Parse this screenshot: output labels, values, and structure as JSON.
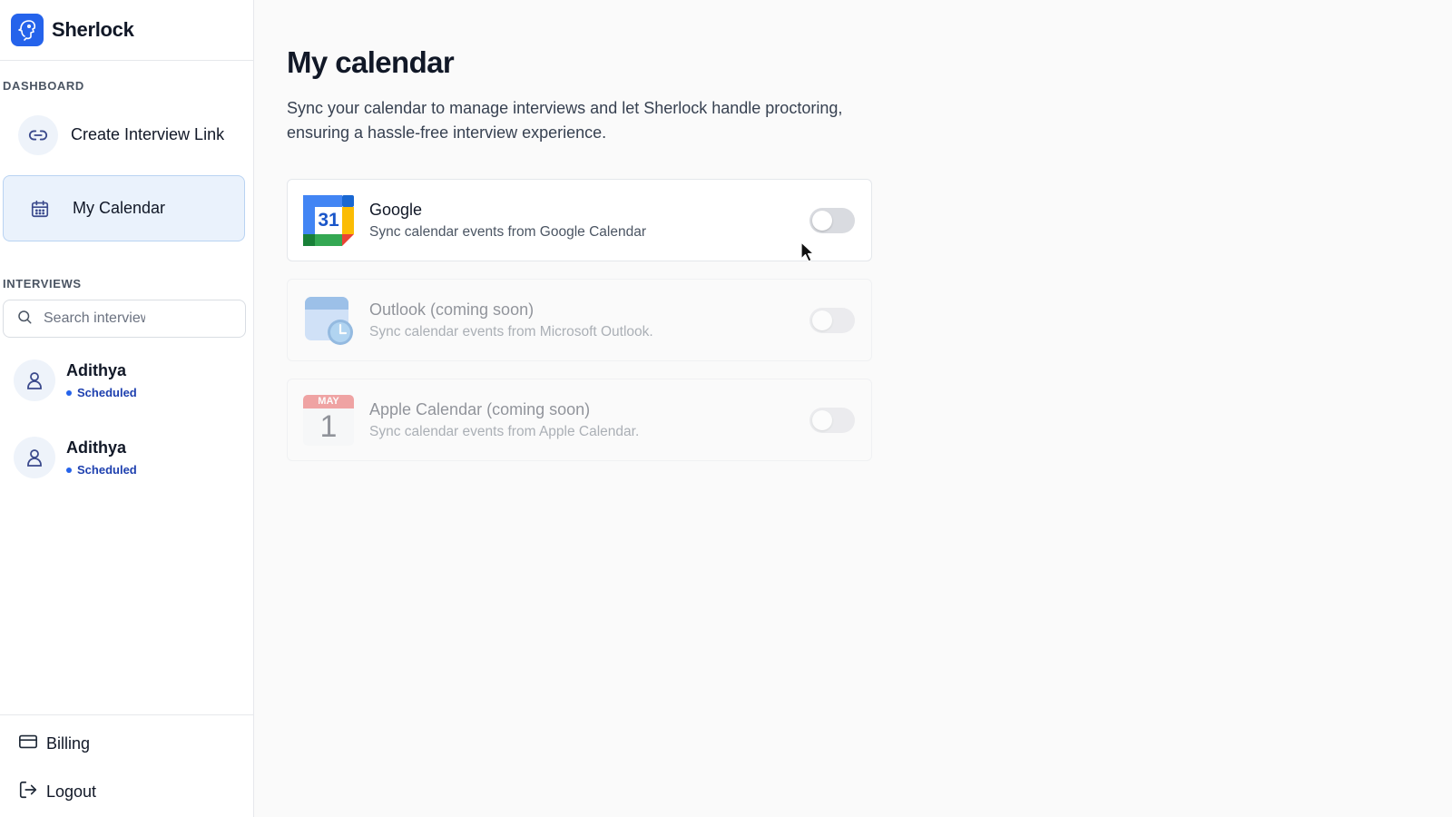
{
  "brand": {
    "name": "Sherlock",
    "color": "#2563eb"
  },
  "sidebar": {
    "dashboard_label": "DASHBOARD",
    "nav": [
      {
        "label": "Create Interview Link",
        "icon": "link-icon"
      },
      {
        "label": "My Calendar",
        "icon": "calendar-icon",
        "active": true
      }
    ],
    "interviews_label": "INTERVIEWS",
    "search_placeholder": "Search interviews",
    "interviews": [
      {
        "name": "Adithya",
        "status": "Scheduled"
      },
      {
        "name": "Adithya",
        "status": "Scheduled"
      }
    ],
    "footer": [
      {
        "label": "Billing",
        "icon": "credit-card-icon"
      },
      {
        "label": "Logout",
        "icon": "logout-icon"
      }
    ]
  },
  "main": {
    "title": "My calendar",
    "description": "Sync your calendar to manage interviews and let Sherlock handle proctoring, ensuring a hassle-free interview experience.",
    "providers": [
      {
        "title": "Google",
        "subtitle": "Sync calendar events from Google Calendar",
        "icon": "google-calendar-icon",
        "icon_text": "31",
        "enabled": false,
        "disabled": false
      },
      {
        "title": "Outlook (coming soon)",
        "subtitle": "Sync calendar events from Microsoft Outlook.",
        "icon": "outlook-calendar-icon",
        "enabled": false,
        "disabled": true
      },
      {
        "title": "Apple Calendar (coming soon)",
        "subtitle": "Sync calendar events from Apple Calendar.",
        "icon": "apple-calendar-icon",
        "icon_month": "MAY",
        "icon_day": "1",
        "enabled": false,
        "disabled": true
      }
    ]
  },
  "colors": {
    "accent": "#2563eb",
    "active_nav_bg": "#eaf2fc",
    "status_text": "#1e40af"
  }
}
